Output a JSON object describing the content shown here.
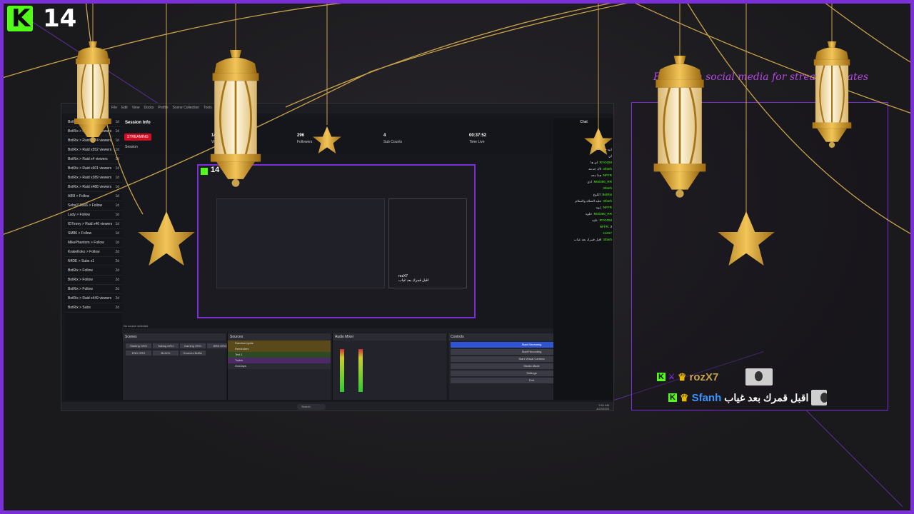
{
  "overlay": {
    "viewer_count": "14",
    "follow_text": "Follow on social media for stream updates"
  },
  "obs": {
    "menu": [
      "File",
      "Edit",
      "View",
      "Docks",
      "Profile",
      "Scene Collection",
      "Tools",
      "Help"
    ],
    "feed": [
      {
        "text": "BotRix > Raid x772 viewers",
        "time": "1d"
      },
      {
        "text": "BotRix > Raid x743 viewers",
        "time": "1d"
      },
      {
        "text": "BotRix > Raid x974 viewers",
        "time": "1d"
      },
      {
        "text": "BotRix > Raid x552 viewers",
        "time": "1d"
      },
      {
        "text": "BotRix > Raid x4 viewers",
        "time": "1d"
      },
      {
        "text": "BotRix > Raid x601 viewers",
        "time": "1d"
      },
      {
        "text": "BotRix > Raid x389 viewers",
        "time": "1d"
      },
      {
        "text": "BotRix > Raid x488 viewers",
        "time": "1d"
      },
      {
        "text": "A89I > Follow",
        "time": "1d"
      },
      {
        "text": "Seba110066 > Follow",
        "time": "1d"
      },
      {
        "text": "Lady > Follow",
        "time": "1d"
      },
      {
        "text": "ID7mmy > Raid x46 viewers",
        "time": "1d"
      },
      {
        "text": "SM86 > Follow",
        "time": "1d"
      },
      {
        "text": "MikePhantom > Follow",
        "time": "1d"
      },
      {
        "text": "KrakeKoko > Follow",
        "time": "2d"
      },
      {
        "text": "N4DE > Subs x1",
        "time": "2d"
      },
      {
        "text": "BotRix > Follow",
        "time": "2d"
      },
      {
        "text": "BotRix > Follow",
        "time": "2d"
      },
      {
        "text": "BotRix > Follow",
        "time": "2d"
      },
      {
        "text": "BotRix > Raid x449 viewers",
        "time": "2d"
      },
      {
        "text": "BotRix > Subs",
        "time": "2d"
      }
    ],
    "session": {
      "title": "Session Info",
      "status": "STREAMING",
      "session_label": "Session",
      "stats": [
        {
          "value": "14",
          "label": "Viewers"
        },
        {
          "value": "296",
          "label": "Followers"
        },
        {
          "value": "4",
          "label": "Sub Counts"
        },
        {
          "value": "00:37:52",
          "label": "Time Live"
        }
      ]
    },
    "no_source": "No source selected",
    "docks": {
      "scenes": "Scenes",
      "sources": "Sources",
      "mixer": "Audio Mixer",
      "controls": "Controls"
    },
    "scenes": [
      "Starting ORG",
      "Talking ORG",
      "Gaming ORG",
      "BRB ORG",
      "END ORG",
      "BLACK",
      "Sources Buffer"
    ],
    "sources": [
      "Random Ignite",
      "Reminders",
      "Text 1",
      "Twitch",
      "Overlays"
    ],
    "controls": [
      "Start Streaming",
      "Start Recording",
      "Start Virtual Camera",
      "Studio Mode",
      "Settings",
      "Exit"
    ],
    "chat": {
      "title": "Chat",
      "messages": [
        {
          "name": "",
          "text": "اتيه ••••••••••"
        },
        {
          "name": "",
          "text": "اي"
        },
        {
          "name": "RYOOM:",
          "text": "اي ها"
        },
        {
          "name": "Sfanh:",
          "text": "لاك جدعه"
        },
        {
          "name": "NFFR:",
          "text": "هذا معه"
        },
        {
          "name": "Mini390_RR:",
          "text": "ادي"
        },
        {
          "name": "Sfanh:",
          "text": ""
        },
        {
          "name": "BotRix:",
          "text": "الكوع"
        },
        {
          "name": "Sfanh:",
          "text": "عليه الصلاه والسلام"
        },
        {
          "name": "NFFR:",
          "text": "تنوه"
        },
        {
          "name": "Mini390_RR:",
          "text": "حلوه"
        },
        {
          "name": "RYOOM:",
          "text": "عليه"
        },
        {
          "name": "NFFR:",
          "text": "3"
        },
        {
          "name": "rozX7:",
          "text": ""
        },
        {
          "name": "Sfanh:",
          "text": "اقبل قمرك بعد غياب"
        }
      ]
    },
    "taskbar": {
      "search": "Search",
      "time": "2:51 AM",
      "date": "4/22/2025"
    }
  },
  "overlay_chat": [
    {
      "name": "rozX7",
      "message": ""
    },
    {
      "name": "Sfanh",
      "message": "اقبل قمرك بعد غياب"
    }
  ]
}
